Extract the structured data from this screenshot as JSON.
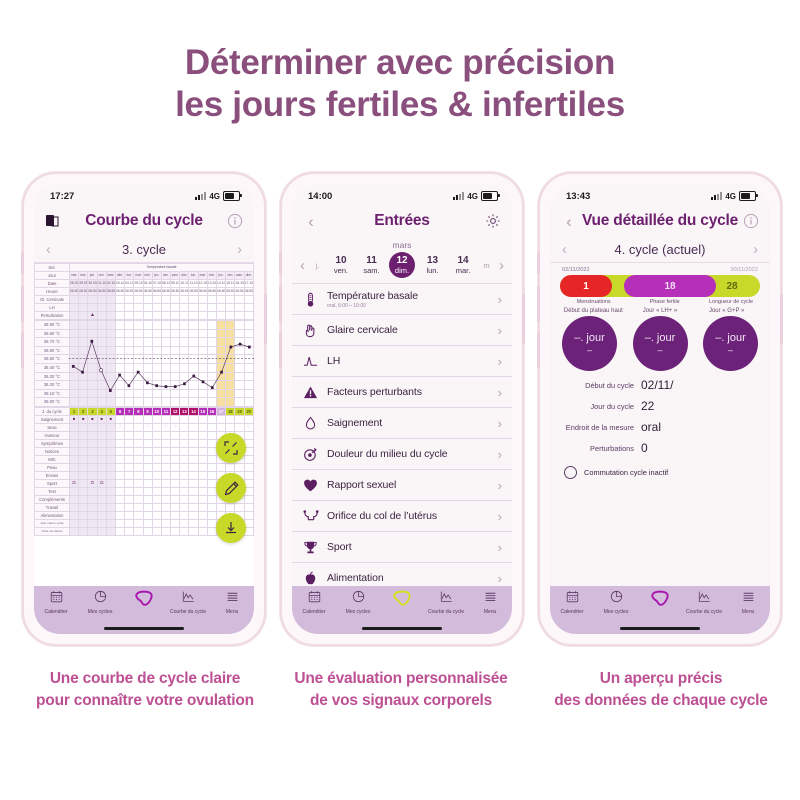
{
  "headline": {
    "line1": "Déterminer avec précision",
    "line2": "les jours fertiles & infertiles",
    "color": "#8a4f7d"
  },
  "colors": {
    "brand_purple": "#6c1f6e",
    "accent_green": "#c8d92a",
    "fertile_purple": "#b52fb8",
    "menstruation_red": "#e62626",
    "caption_pink": "#bd4f93",
    "nav_bar": "#d3bcdb"
  },
  "phone1": {
    "status": {
      "time": "17:27",
      "network": "4G"
    },
    "appbar": {
      "left_icon": "document-icon",
      "title": "Courbe du cycle",
      "right_icon": "info-icon"
    },
    "cycle_selector": {
      "prev": "‹",
      "label": "3. cycle",
      "next": "›"
    },
    "chart": {
      "header_left": "Sel.",
      "header_title": "Température basale",
      "row_labels": [
        "Jour",
        "Date",
        "Heure",
        "Gl. Cervicale",
        "LH",
        "Perturbation"
      ],
      "temp_labels": [
        "36.90 °C",
        "36.80 °C",
        "36.70 °C",
        "36.60 °C",
        "36.50 °C",
        "36.40 °C",
        "36.30 °C",
        "36.20 °C",
        "36.10 °C",
        "36.00 °C"
      ],
      "lower_row_labels": [
        "J. du cycle",
        "Saignement",
        "Sexe",
        "Humeur",
        "Symptômes",
        "Notices",
        "IMC",
        "Peau",
        "Envies",
        "Sport",
        "Test",
        "Compléments",
        "Travail",
        "Alimentation",
        "Jour même cycle",
        "Infos col utérus"
      ],
      "day_headers": [
        "mar.",
        "mer.",
        "jeu.",
        "ven.",
        "sam.",
        "dim.",
        "lun.",
        "mar.",
        "mer.",
        "jeu.",
        "ven.",
        "sam.",
        "dim.",
        "lun.",
        "mar.",
        "mer.",
        "jeu.",
        "ven.",
        "sam.",
        "dim."
      ],
      "dates": [
        "28.09",
        "29.09",
        "30.09",
        "01.10",
        "02.10",
        "03.10",
        "04.10",
        "05.10",
        "06.10",
        "07.10",
        "08.10",
        "09.10",
        "10.10",
        "11.10",
        "12.10",
        "13.10",
        "14.10",
        "15.10",
        "16.10",
        "17.10"
      ],
      "times": [
        "06:50",
        "06:50",
        "06:50",
        "06:50",
        "06:50",
        "06:50",
        "06:50",
        "06:50",
        "06:50",
        "06:50",
        "06:50",
        "06:50",
        "06:50",
        "06:50",
        "06:50",
        "06:50",
        "06:50",
        "06:50",
        "06:50",
        "06:50"
      ],
      "cycle_days": [
        "1",
        "2",
        "3",
        "4",
        "5",
        "6",
        "7",
        "8",
        "9",
        "10",
        "11",
        "12",
        "13",
        "14",
        "15",
        "16",
        "17",
        "18",
        "19",
        "20"
      ]
    },
    "fabs": [
      "fullscreen-icon",
      "pencil-icon",
      "download-icon"
    ],
    "nav": [
      {
        "icon": "calendar-icon",
        "label": "Calendrier"
      },
      {
        "icon": "pie-chart-icon",
        "label": "Mes cycles"
      },
      {
        "icon": "logo-icon",
        "label": ""
      },
      {
        "icon": "curve-icon",
        "label": "Courbe du cycle"
      },
      {
        "icon": "menu-icon",
        "label": "Menu"
      }
    ]
  },
  "phone2": {
    "status": {
      "time": "14:00",
      "network": "4G"
    },
    "appbar": {
      "left_icon": "back-chevron-icon",
      "title": "Entrées",
      "right_icon": "gear-icon"
    },
    "month": "mars",
    "days": [
      {
        "num": "",
        "wd": "j.",
        "edge": true
      },
      {
        "num": "10",
        "wd": "ven.",
        "selected": false
      },
      {
        "num": "11",
        "wd": "sam.",
        "selected": false
      },
      {
        "num": "12",
        "wd": "dim.",
        "selected": true
      },
      {
        "num": "13",
        "wd": "lun.",
        "selected": false
      },
      {
        "num": "14",
        "wd": "mar.",
        "selected": false
      },
      {
        "num": "",
        "wd": "m",
        "edge": true
      }
    ],
    "entries": [
      {
        "icon": "thermometer-icon",
        "title": "Température basale",
        "sub": "oral, 6:00 – 10:00"
      },
      {
        "icon": "hand-icon",
        "title": "Glaire cervicale",
        "sub": ""
      },
      {
        "icon": "lh-peak-icon",
        "title": "LH",
        "sub": ""
      },
      {
        "icon": "warning-icon",
        "title": "Facteurs perturbants",
        "sub": ""
      },
      {
        "icon": "drop-icon",
        "title": "Saignement",
        "sub": ""
      },
      {
        "icon": "target-icon",
        "title": "Douleur du milieu du cycle",
        "sub": ""
      },
      {
        "icon": "heart-icon",
        "title": "Rapport sexuel",
        "sub": ""
      },
      {
        "icon": "uterus-icon",
        "title": "Orifice du col de l’utérus",
        "sub": ""
      },
      {
        "icon": "trophy-icon",
        "title": "Sport",
        "sub": ""
      },
      {
        "icon": "apple-icon",
        "title": "Alimentation",
        "sub": ""
      }
    ],
    "nav": [
      {
        "icon": "calendar-icon",
        "label": "Calendrier"
      },
      {
        "icon": "pie-chart-icon",
        "label": "Mes cycles"
      },
      {
        "icon": "logo-icon",
        "label": ""
      },
      {
        "icon": "curve-icon",
        "label": "Courbe du cycle"
      },
      {
        "icon": "menu-icon",
        "label": "Menu"
      }
    ]
  },
  "phone3": {
    "status": {
      "time": "13:43",
      "network": "4G"
    },
    "appbar": {
      "left_icon": "back-chevron-icon",
      "title": "Vue détaillée du cycle",
      "right_icon": "info-icon"
    },
    "cycle_selector": {
      "prev": "‹",
      "label": "4. cycle (actuel)",
      "next": "›"
    },
    "date_start": "02/11/2022",
    "date_end": "30/11/2022",
    "bar": {
      "menstruation_value": "1",
      "fertile_value": "18",
      "length_value": "28",
      "label_menstruation": "Menstruations",
      "label_fertile": "Phase fertile",
      "label_length": "Longueur de cycle"
    },
    "circles": [
      {
        "label": "Début du plateau haut",
        "value": "–. jour",
        "sub": "–"
      },
      {
        "label": "Jour « LH+ »",
        "value": "–. jour",
        "sub": "–"
      },
      {
        "label": "Jour « G+P »",
        "value": "–. jour",
        "sub": "–"
      }
    ],
    "details": [
      {
        "key": "Début du cycle",
        "value": "02/11/"
      },
      {
        "key": "Jour du cycle",
        "value": "22"
      },
      {
        "key": "Endroit de la mesure",
        "value": "oral"
      },
      {
        "key": "Perturbations",
        "value": "0"
      }
    ],
    "checkbox_label": "Commutation cycle inactif",
    "nav": [
      {
        "icon": "calendar-icon",
        "label": "Calendrier"
      },
      {
        "icon": "pie-chart-icon",
        "label": "Mes cycles"
      },
      {
        "icon": "logo-icon",
        "label": ""
      },
      {
        "icon": "curve-icon",
        "label": "Courbe du cycle"
      },
      {
        "icon": "menu-icon",
        "label": "Menu"
      }
    ]
  },
  "captions": {
    "c1_l1": "Une courbe de cycle claire",
    "c1_l2": "pour connaître votre ovulation",
    "c2_l1": "Une évaluation personnalisée",
    "c2_l2": "de vos signaux corporels",
    "c3_l1": "Un aperçu précis",
    "c3_l2": "des données de chaque cycle"
  },
  "chart_data": {
    "type": "line",
    "title": "Courbe du cycle – Température basale",
    "xlabel": "Jour du cycle",
    "ylabel": "Température basale (°C)",
    "ylim": [
      36.0,
      36.9
    ],
    "yticks": [
      36.0,
      36.1,
      36.2,
      36.3,
      36.4,
      36.5,
      36.6,
      36.7,
      36.8,
      36.9
    ],
    "grid": true,
    "coverline": 36.5,
    "x": [
      1,
      2,
      3,
      4,
      5,
      6,
      7,
      8,
      9,
      10,
      11,
      12,
      13,
      14,
      15,
      16,
      17,
      18,
      19,
      20
    ],
    "values": [
      36.42,
      36.36,
      36.68,
      36.38,
      36.17,
      36.33,
      36.22,
      36.36,
      36.25,
      36.22,
      36.21,
      36.21,
      36.24,
      36.32,
      36.26,
      36.2,
      36.36,
      36.62,
      36.65,
      36.62
    ],
    "open_point_index": 3,
    "highlight_band": {
      "from": 17,
      "to": 18,
      "color": "#f6dfa0"
    },
    "cycle_day_colors": [
      "#c8d92a",
      "#c8d92a",
      "#c8d92a",
      "#c8d92a",
      "#c8d92a",
      "#b52fb8",
      "#b52fb8",
      "#b52fb8",
      "#b52fb8",
      "#b52fb8",
      "#b52fb8",
      "#b0106a",
      "#b0106a",
      "#b0106a",
      "#b52fb8",
      "#b52fb8",
      "#d4b4de",
      "#c8d92a",
      "#c8d92a",
      "#c8d92a"
    ]
  }
}
